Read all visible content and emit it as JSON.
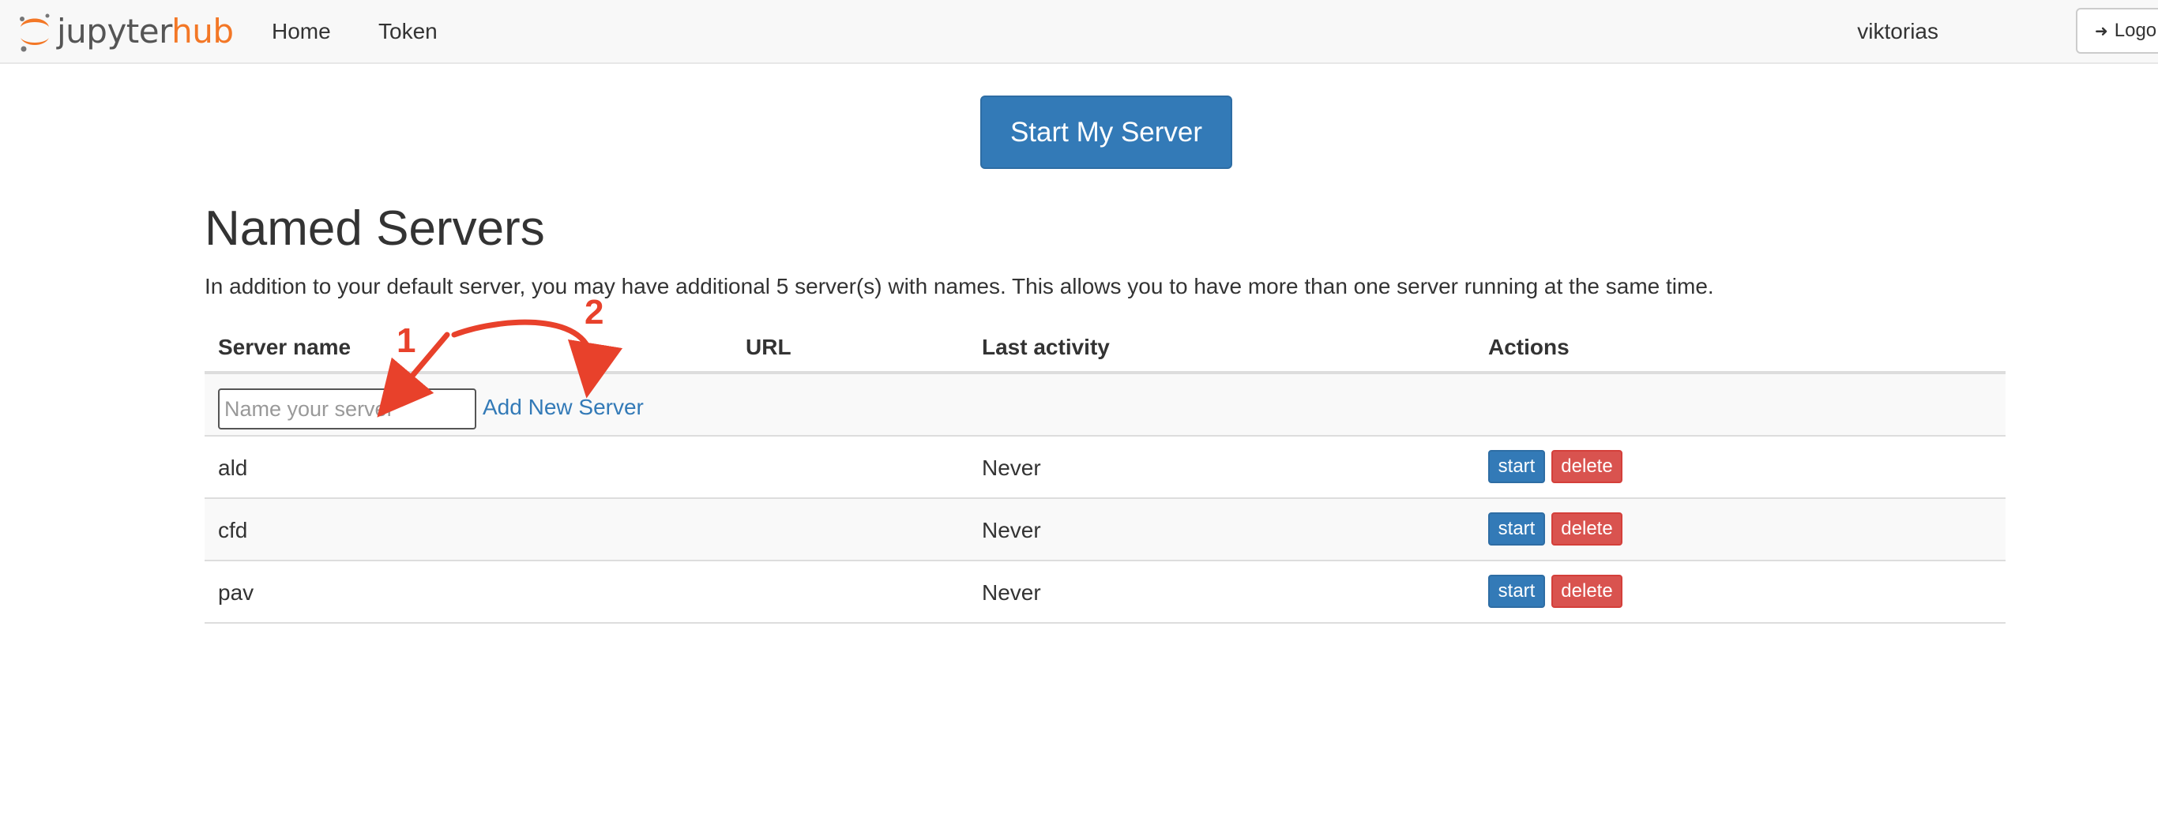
{
  "navbar": {
    "logo_text_main": "jupyter",
    "logo_text_accent": "hub",
    "links": {
      "home": "Home",
      "token": "Token"
    },
    "username": "viktorias",
    "logout_label": "Logo"
  },
  "start_button_label": "Start My Server",
  "named_servers": {
    "heading": "Named Servers",
    "description": "In addition to your default server, you may have additional 5 server(s) with names. This allows you to have more than one server running at the same time.",
    "columns": {
      "server_name": "Server name",
      "url": "URL",
      "last_activity": "Last activity",
      "actions": "Actions"
    },
    "new_server": {
      "placeholder": "Name your server",
      "add_label": "Add New Server"
    },
    "rows": [
      {
        "name": "ald",
        "url": "",
        "last_activity": "Never",
        "start": "start",
        "delete": "delete"
      },
      {
        "name": "cfd",
        "url": "",
        "last_activity": "Never",
        "start": "start",
        "delete": "delete"
      },
      {
        "name": "pav",
        "url": "",
        "last_activity": "Never",
        "start": "start",
        "delete": "delete"
      }
    ]
  },
  "annotations": {
    "step_1": "1",
    "step_2": "2",
    "color": "#e8412b"
  },
  "colors": {
    "primary": "#337ab7",
    "danger": "#d9534f",
    "jupyter_orange": "#f37726",
    "navbar_bg": "#f8f8f8"
  },
  "icons": {
    "logo": "jupyter-logo-icon",
    "logout": "sign-out-icon"
  }
}
